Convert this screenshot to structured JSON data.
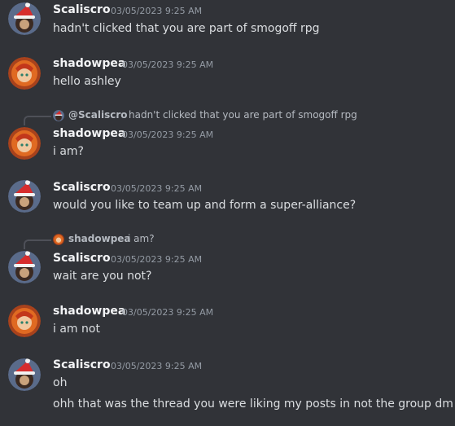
{
  "messages": [
    {
      "author": "Scaliscro",
      "timestamp": "03/05/2023 9:25 AM",
      "lines": [
        "hadn't clicked that you are part of smogoff rpg"
      ]
    },
    {
      "author": "shadowpea",
      "timestamp": "03/05/2023 9:25 AM",
      "lines": [
        "hello ashley"
      ]
    },
    {
      "author": "shadowpea",
      "timestamp": "03/05/2023 9:25 AM",
      "lines": [
        "i am?"
      ],
      "reply": {
        "author": "@Scaliscro",
        "text": "hadn't clicked that you are part of smogoff rpg"
      }
    },
    {
      "author": "Scaliscro",
      "timestamp": "03/05/2023 9:25 AM",
      "lines": [
        "would you like to team up and form a super-alliance?"
      ]
    },
    {
      "author": "Scaliscro",
      "timestamp": "03/05/2023 9:25 AM",
      "lines": [
        "wait are you not?"
      ],
      "reply": {
        "author": "shadowpea",
        "text": "i am?"
      }
    },
    {
      "author": "shadowpea",
      "timestamp": "03/05/2023 9:25 AM",
      "lines": [
        "i am not"
      ]
    },
    {
      "author": "Scaliscro",
      "timestamp": "03/05/2023 9:25 AM",
      "lines": [
        "oh",
        "ohh that was the thread you were liking my posts in not the group dm"
      ]
    }
  ],
  "colors": {
    "background": "#313338",
    "username": "#f2f3f5",
    "timestamp": "#949ba4",
    "text": "#dbdee1"
  }
}
